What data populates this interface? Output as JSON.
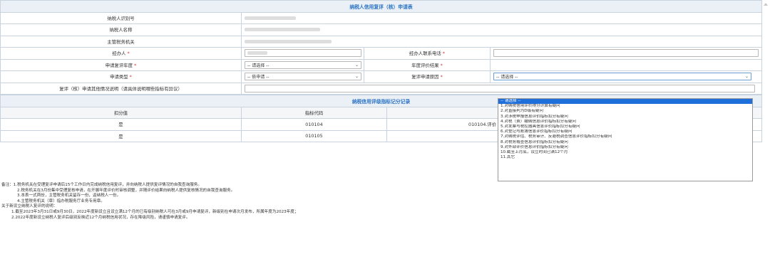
{
  "form": {
    "title": "纳税人信用复评（核）申请表",
    "taxpayer_id_label": "纳税人识别号",
    "taxpayer_name_label": "纳税人名称",
    "tax_authority_label": "主管税务机关",
    "agent_label": "经办人",
    "agent_phone_label": "经办人联系电话",
    "review_year_label": "申请复评年度",
    "review_year_value": "-- 请选择 --",
    "annual_result_label": "年度评价结果",
    "apply_type_label": "申请类型",
    "apply_type_value": "-- 依申请 --",
    "review_reason_label": "复评申请原因",
    "review_reason_value": "-- 请选择 --",
    "explain_label": "复评（核）申请其他情况说明（请具体说明哪些指标有异议）",
    "required_mark": "*"
  },
  "record": {
    "title": "纳税信用评级指标记分记录",
    "col_score": "扣分值",
    "col_code": "指标代码",
    "rows": [
      {
        "score": "是",
        "code": "010104",
        "desc": "010104.评价"
      },
      {
        "score": "是",
        "code": "010105",
        "desc": ""
      }
    ]
  },
  "dropdown": {
    "options": [
      "-- 请选择 --",
      "1.对纳税信用评价得分计算有疑问",
      "2.对直接判为D级有疑问",
      "3.对涉税申报信息评价指标扣分有疑问",
      "4.对税（费）缴纳信息评价指标扣分有疑问",
      "5.对发票与税控器具信息评价指标扣分有疑问",
      "6.对登记与账簿信息评价指标扣分有疑问",
      "7.对纳税评估、税务审计、反避税调查信息评价指标扣分有疑问",
      "8.对税务稽查信息评价指标扣分有疑问",
      "9.对外部评价信息评价指标扣分有疑问",
      "10.截至上月底，设立时间已满12个月",
      "11.其它"
    ],
    "selected_index": 0
  },
  "notes": {
    "prefix": "备注：",
    "items": [
      "1.税务机关在受理复评申请后15个工作日内完成纳税信用复评，并向纳税人提供复评情况的自我查询服务。",
      "2.税务机关在3月份集中受理复核申请，在开展年度评价时审核调整，并随评价结果向纳税人提供复核情况的自我查询服务。",
      "3.本表一式两份，主管税务机关留存一份，返纳税人一份。",
      "4.主管税务机关（章）指办税服务厅业务专用章。"
    ],
    "new_title": "关于新设立纳税人复评的说明：",
    "new_items": [
      "1.截至2023年3月31日或9月30日，2022年度新设立且设立满12个月的已有级别纳税人可在3月或9月申请复评，新级别在申请次月发布，所属年度为2023年度；",
      "2.2022年度新设立纳税人复评后级别反映近12个月纳税信用状况，存在降级风险，请谨慎申请复评。"
    ]
  }
}
